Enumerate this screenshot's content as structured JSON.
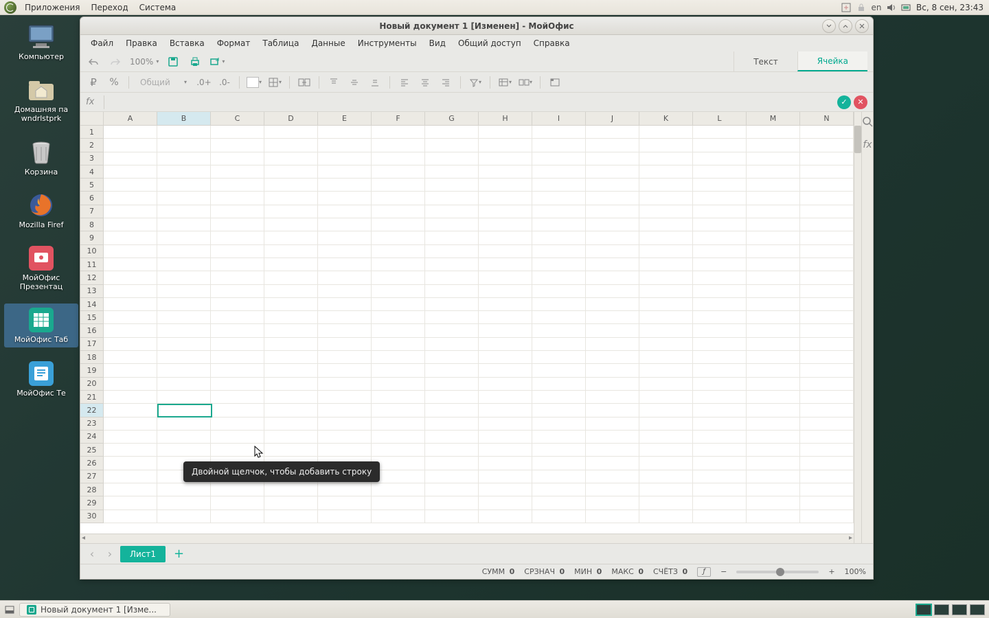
{
  "top_panel": {
    "menus": [
      "Приложения",
      "Переход",
      "Система"
    ],
    "lang": "en",
    "clock": "Вс,  8 сен, 23:43"
  },
  "desktop": {
    "icons": [
      {
        "name": "computer-icon",
        "label": "Компьютер"
      },
      {
        "name": "home-folder-icon",
        "label": "Домашняя па\nwndrlstprk"
      },
      {
        "name": "trash-icon",
        "label": "Корзина"
      },
      {
        "name": "firefox-icon",
        "label": "Mozilla Firef"
      },
      {
        "name": "presentation-app-icon",
        "label": "МойОфис\nПрезентац"
      },
      {
        "name": "spreadsheet-app-icon",
        "label": "МойОфис Таб",
        "selected": true
      },
      {
        "name": "text-app-icon",
        "label": "МойОфис Те"
      }
    ]
  },
  "window": {
    "title": "Новый документ 1 [Изменен] - МойОфис",
    "menus": [
      "Файл",
      "Правка",
      "Вставка",
      "Формат",
      "Таблица",
      "Данные",
      "Инструменты",
      "Вид",
      "Общий доступ",
      "Справка"
    ],
    "zoom": "100%",
    "tabs": {
      "text": "Текст",
      "cell": "Ячейка"
    },
    "number_format": "Общий",
    "fx_label": "fx",
    "columns": [
      "A",
      "B",
      "C",
      "D",
      "E",
      "F",
      "G",
      "H",
      "I",
      "J",
      "K",
      "L",
      "M",
      "N"
    ],
    "row_count": 30,
    "active_col": "B",
    "active_row": 22,
    "sheet_tab": "Лист1",
    "status": {
      "sum_l": "СУММ",
      "sum_v": "0",
      "avg_l": "СРЗНАЧ",
      "avg_v": "0",
      "min_l": "МИН",
      "min_v": "0",
      "max_l": "МАКС",
      "max_v": "0",
      "cnt_l": "СЧЁТЗ",
      "cnt_v": "0",
      "fn": "ƒ",
      "zoom": "100%"
    },
    "tooltip": "Двойной щелчок, чтобы добавить строку"
  },
  "taskbar": {
    "task": "Новый документ 1 [Изме..."
  }
}
